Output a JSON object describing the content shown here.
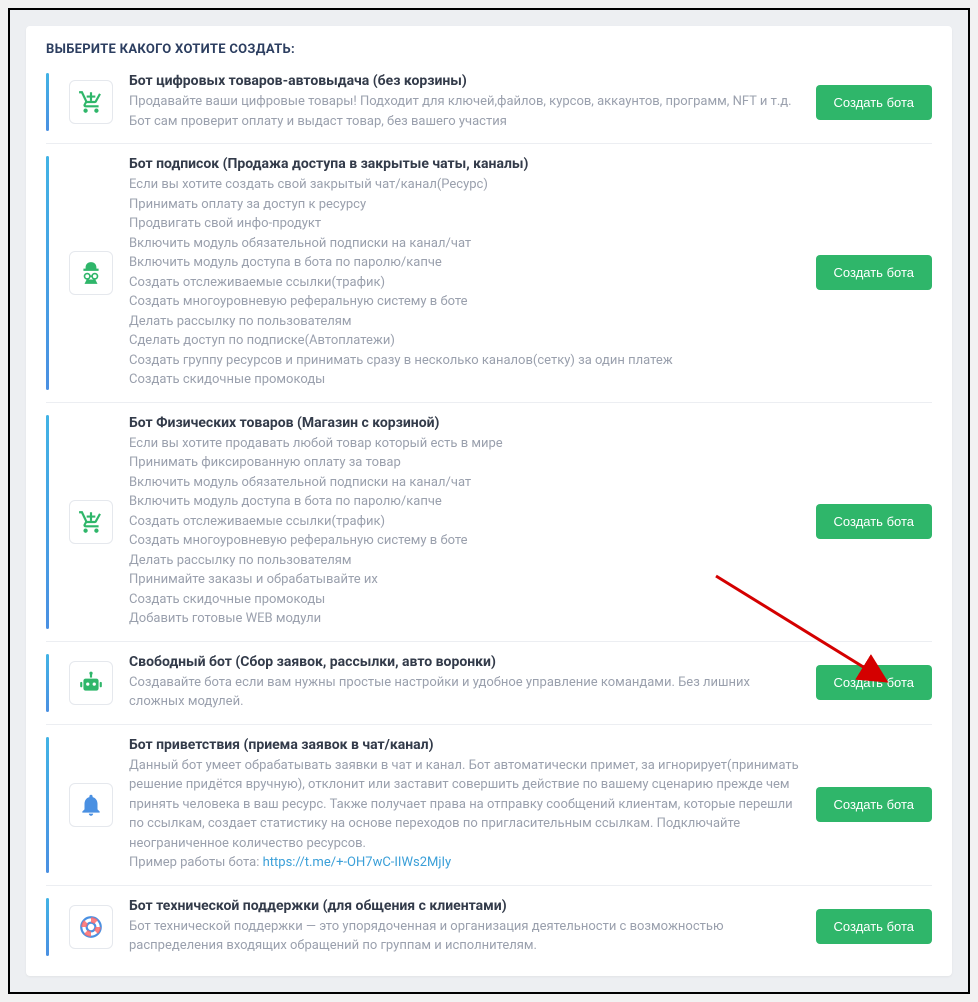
{
  "heading": "ВЫБЕРИТЕ КАКОГО ХОТИТЕ СОЗДАТЬ:",
  "button_label": "Создать бота",
  "items": [
    {
      "icon": "cart-icon",
      "title": "Бот цифровых товаров-автовыдача (без корзины)",
      "lines": [
        "Продавайте ваши цифровые товары! Подходит для ключей,файлов, курсов, аккаунтов, программ, NFT и т.д. Бот сам проверит оплату и выдаст товар, без вашего участия"
      ]
    },
    {
      "icon": "spy-icon",
      "title": "Бот подписок (Продажа доступа в закрытые чаты, каналы)",
      "lines": [
        "Если вы хотите создать свой закрытый чат/канал(Ресурс)",
        "Принимать оплату за доступ к ресурсу",
        "Продвигать свой инфо-продукт",
        "Включить модуль обязательной подписки на канал/чат",
        "Включить модуль доступа в бота по паролю/капче",
        "Создать отслеживаемые ссылки(трафик)",
        "Создать многоуровневую реферальную систему в боте",
        "Делать рассылку по пользователям",
        "Сделать доступ по подписке(Автоплатежи)",
        "Создать группу ресурсов и принимать сразу в несколько каналов(сетку) за один платеж",
        "Создать скидочные промокоды"
      ]
    },
    {
      "icon": "cart-icon",
      "title": "Бот Физических товаров (Магазин с корзиной)",
      "lines": [
        "Если вы хотите продавать любой товар который есть в мире",
        "Принимать фиксированную оплату за товар",
        "Включить модуль обязательной подписки на канал/чат",
        "Включить модуль доступа в бота по паролю/капче",
        "Создать отслеживаемые ссылки(трафик)",
        "Создать многоуровневую реферальную систему в боте",
        "Делать рассылку по пользователям",
        "Принимайте заказы и обрабатывайте их",
        "Создать скидочные промокоды",
        "Добавить готовые WEB модули"
      ]
    },
    {
      "icon": "robot-icon",
      "title": "Свободный бот (Сбор заявок, рассылки, авто воронки)",
      "lines": [
        "Создавайте бота если вам нужны простые настройки и удобное управление командами. Без лишних сложных модулей."
      ]
    },
    {
      "icon": "bell-icon",
      "title": "Бот приветствия (приема заявок в чат/канал)",
      "lines": [
        "Данный бот умеет обрабатывать заявки в чат и канал. Бот автоматически примет, за игнорирует(принимать решение придётся вручную), отклонит или заставит совершить действие по вашему сценарию прежде чем принять человека в ваш ресурс. Также получает права на отправку сообщений клиентам, которые перешли по ссылкам, создает статистику на основе переходов по пригласительным ссылкам. Подключайте неограниченное количество ресурсов."
      ],
      "link_prefix": "Пример работы бота: ",
      "link": "https://t.me/+-OH7wC-IIWs2MjIy"
    },
    {
      "icon": "lifebuoy-icon",
      "title": "Бот технической поддержки (для общения с клиентами)",
      "lines": [
        "Бот технической поддержки — это упорядоченная и организация деятельности с возможностью распределения входящих обращений по группам и исполнителям."
      ]
    }
  ]
}
